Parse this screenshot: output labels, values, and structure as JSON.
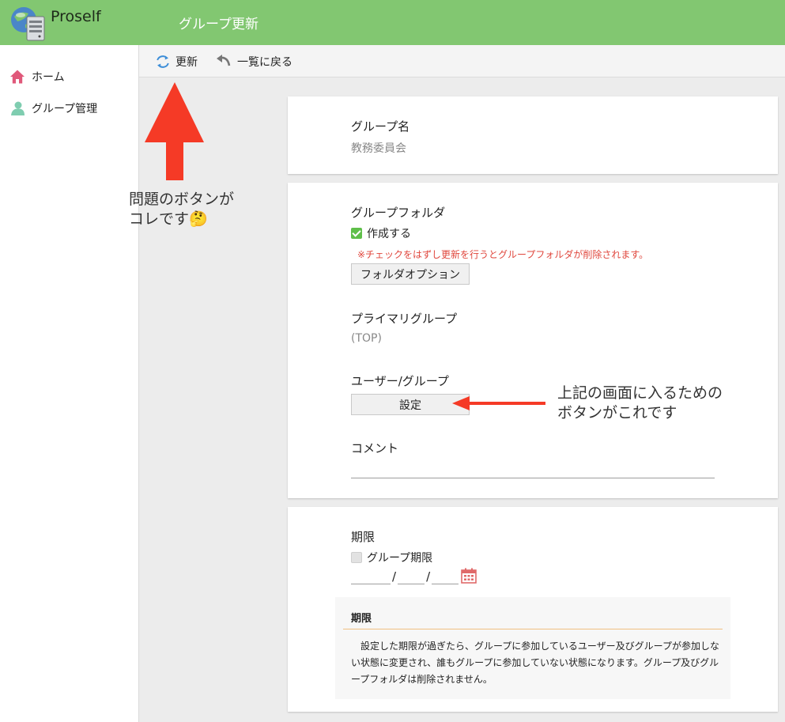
{
  "header": {
    "app_name": "Proself",
    "page_title": "グループ更新"
  },
  "sidebar": {
    "items": [
      {
        "label": "ホーム",
        "icon": "home-icon"
      },
      {
        "label": "グループ管理",
        "icon": "user-icon"
      }
    ]
  },
  "toolbar": {
    "refresh_label": "更新",
    "back_label": "一覧に戻る"
  },
  "group_name": {
    "label": "グループ名",
    "value": "教務委員会"
  },
  "group_folder": {
    "label": "グループフォルダ",
    "create_label": "作成する",
    "create_checked": true,
    "warning": "※チェックをはずし更新を行うとグループフォルダが削除されます。",
    "options_button": "フォルダオプション"
  },
  "primary_group": {
    "label": "プライマリグループ",
    "value": "(TOP)"
  },
  "users_groups": {
    "label": "ユーザー/グループ",
    "button": "設定"
  },
  "comment": {
    "label": "コメント",
    "value": ""
  },
  "expiry": {
    "label": "期限",
    "checkbox_label": "グループ期限",
    "checked": false,
    "date_separator": "/",
    "info_title": "期限",
    "info_text": "　設定した期限が過ぎたら、グループに参加しているユーザー及びグループが参加しない状態に変更され、誰もグループに参加していない状態になります。グループ及びグループフォルダは削除されません。"
  },
  "annotations": {
    "top_note_line1": "問題のボタンが",
    "top_note_line2": "コレです🤔",
    "right_note_line1": "上記の画面に入るための",
    "right_note_line2": "ボタンがこれです"
  },
  "colors": {
    "header": "#82c771",
    "warning": "#e0473d",
    "annotation_arrow": "#f53a26",
    "checkbox_on": "#5fbf4a"
  }
}
